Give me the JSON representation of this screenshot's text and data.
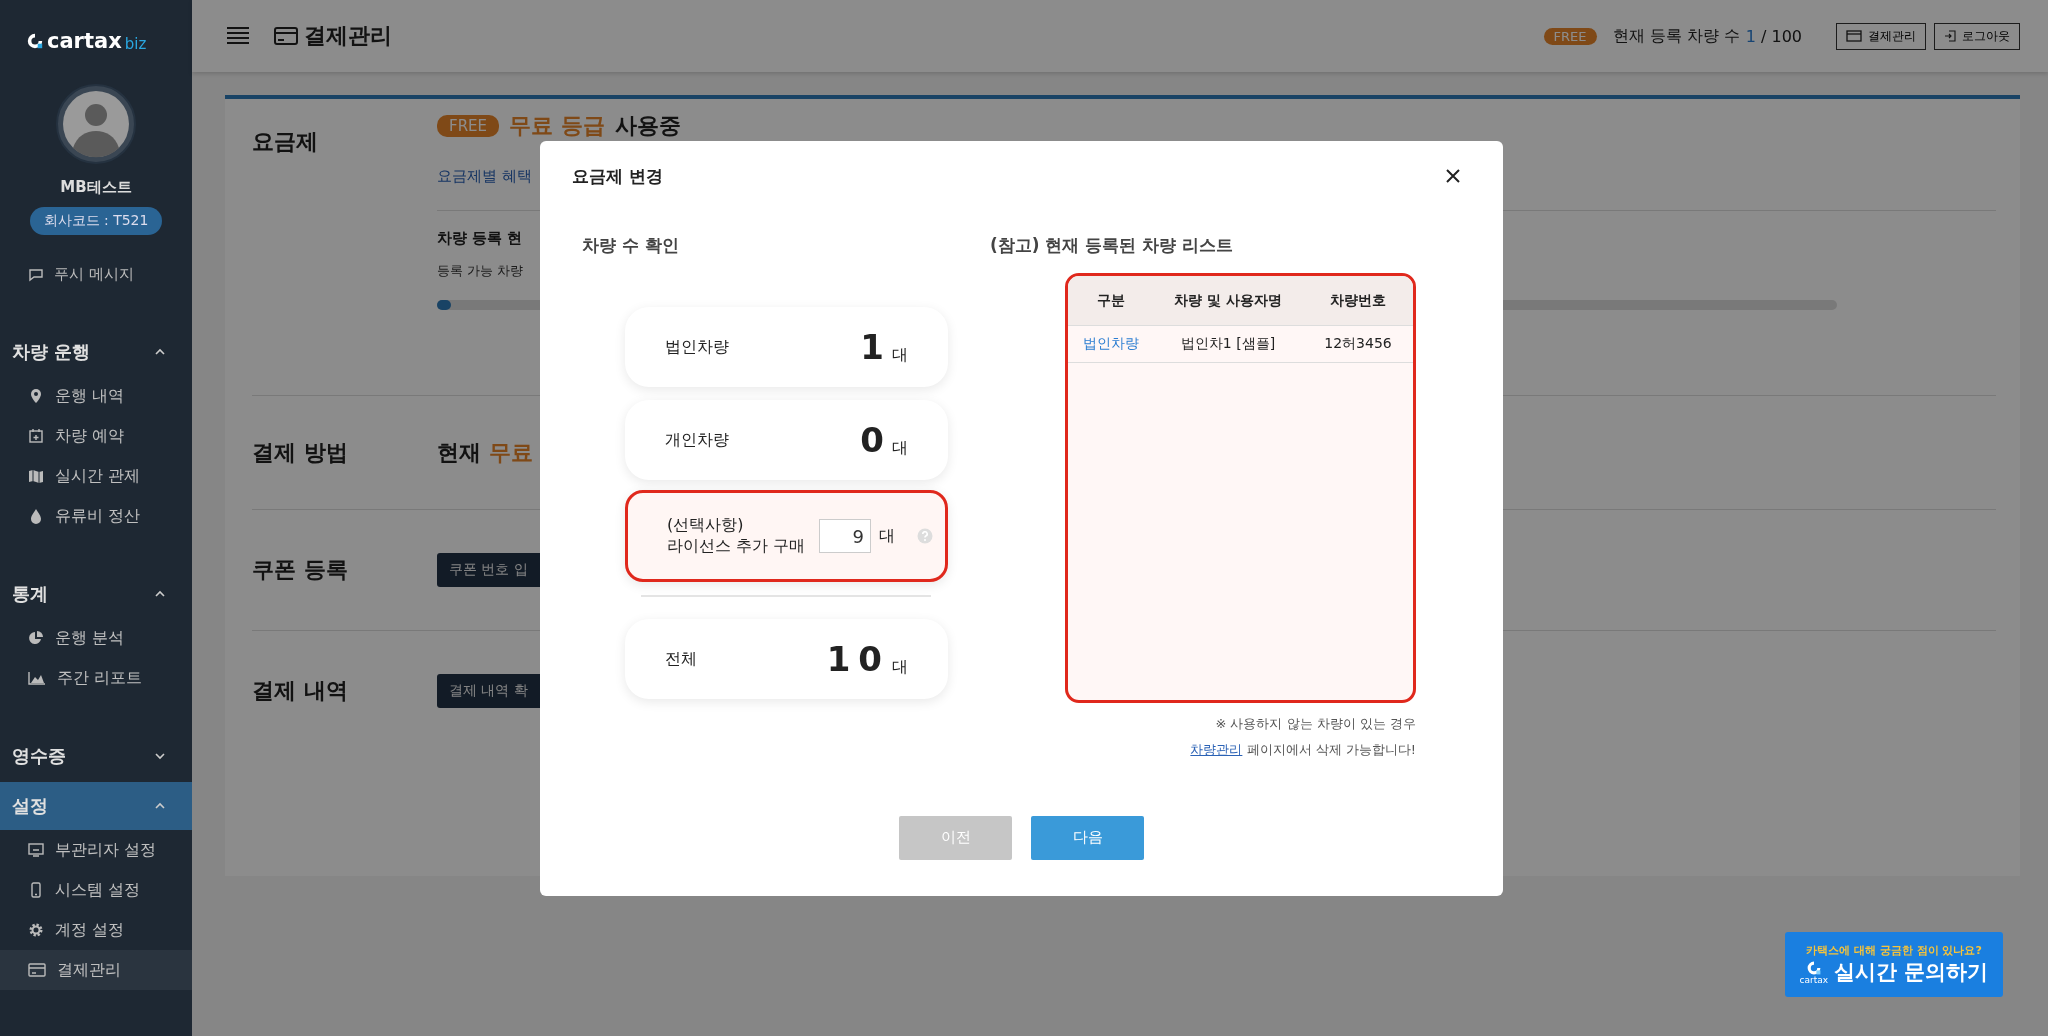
{
  "sidebar": {
    "logo": {
      "name": "cartax",
      "suffix": "biz"
    },
    "user": {
      "name": "MB테스트",
      "company_code": "회사코드 : T521"
    },
    "push": {
      "label": "푸시 메시지"
    },
    "sections": [
      {
        "title": "차량 운행",
        "expanded": true,
        "selected": false,
        "items": [
          {
            "label": "운행 내역",
            "selected": false
          },
          {
            "label": "차량 예약",
            "selected": false
          },
          {
            "label": "실시간 관제",
            "selected": false
          },
          {
            "label": "유류비 정산",
            "selected": false
          }
        ]
      },
      {
        "title": "통계",
        "expanded": true,
        "selected": false,
        "items": [
          {
            "label": "운행 분석",
            "selected": false
          },
          {
            "label": "주간 리포트",
            "selected": false
          }
        ]
      },
      {
        "title": "영수증",
        "expanded": false,
        "selected": false
      },
      {
        "title": "설정",
        "expanded": true,
        "selected": true,
        "items": [
          {
            "label": "부관리자 설정",
            "selected": false
          },
          {
            "label": "시스템 설정",
            "selected": false
          },
          {
            "label": "계정 설정",
            "selected": false
          },
          {
            "label": "결제관리",
            "selected": true
          }
        ]
      }
    ]
  },
  "topbar": {
    "title": "결제관리",
    "plan_badge": "FREE",
    "count_label": "현재 등록 차량 수",
    "count": "1",
    "count_total": "/ 100",
    "buttons": [
      "결제관리",
      "로그아웃"
    ]
  },
  "content": {
    "plan": {
      "label": "요금제",
      "badge": "FREE",
      "name": "무료 등급",
      "suffix": "사용중",
      "link": "요금제별 혜택",
      "status_title": "차량 등록 현",
      "status_text": "등록 가능 차량",
      "level": 0.01
    },
    "payment": {
      "label": "결제 방법",
      "text": "현재",
      "highlight": "무료"
    },
    "coupon": {
      "label": "쿠폰 등록",
      "button": "쿠폰 번호 입"
    },
    "history": {
      "label": "결제 내역",
      "button": "결제 내역 확"
    }
  },
  "modal": {
    "title": "요금제 변경",
    "left_title": "차량 수 확인",
    "counts": [
      {
        "kind": "count",
        "label": "법인차량",
        "value": "1",
        "unit": "대"
      },
      {
        "kind": "count",
        "label": "개인차량",
        "value": "0",
        "unit": "대"
      },
      {
        "kind": "input",
        "label": "(선택사항)",
        "label_2": "라이선스 추가 구매",
        "value": "9",
        "unit": "대"
      },
      {
        "kind": "total",
        "label": "전체",
        "value": "10",
        "unit": "대"
      }
    ],
    "right_title": "(참고) 현재 등록된 차량 리스트",
    "columns": [
      "구분",
      "차량 및 사용자명",
      "차량번호"
    ],
    "rows": [
      {
        "type": "법인차량",
        "name": "법인차1 [샘플]",
        "plate": "12허3456"
      }
    ],
    "note": "※ 사용하지 않는 차량이 있는 경우",
    "note_link": "차량관리",
    "note_rest": "페이지에서 삭제 가능합니다!",
    "buttons": [
      {
        "label": "이전",
        "disabled": true
      },
      {
        "label": "다음",
        "disabled": false
      }
    ]
  },
  "chat": {
    "question": "카택스에 대해 궁금한 점이 있나요?",
    "logo": "cartax",
    "label": "실시간 문의하기"
  }
}
